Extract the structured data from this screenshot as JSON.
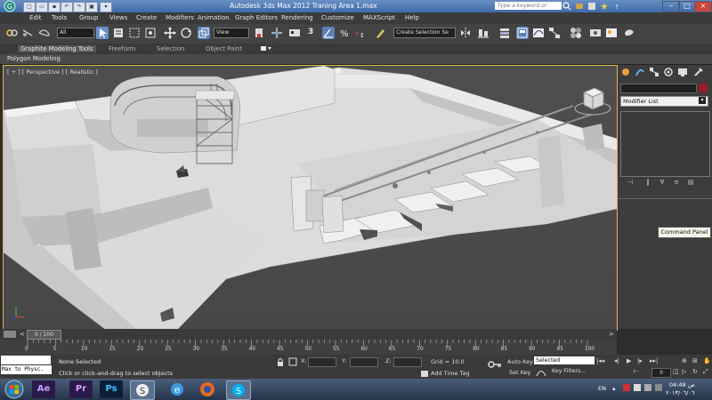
{
  "titlebar": {
    "title": "Autodesk 3ds Max  2012     Traning Area 1.max",
    "search_placeholder": "Type a keyword or phrase",
    "min": "–",
    "max": "□",
    "close": "×"
  },
  "menu": [
    "Edit",
    "Tools",
    "Group",
    "Views",
    "Create",
    "Modifiers",
    "Animation",
    "Graph Editors",
    "Rendering",
    "Customize",
    "MAXScript",
    "Help"
  ],
  "toolbar": {
    "filter_value": "All",
    "refcoord_value": "View",
    "selection_set_value": "Create Selection Se",
    "snap_label": "3",
    "angle_snap_label": "n"
  },
  "ribbon": {
    "tabs": [
      "Graphite Modeling Tools",
      "Freeform",
      "Selection",
      "Object Paint"
    ],
    "sub_label": "Polygon Modeling"
  },
  "viewport": {
    "label": "[ + ] [ Perspective ] [ Realistic ]"
  },
  "command_panel": {
    "modifier_list": "Modifier List",
    "tooltip": "Command Panel",
    "colors": {
      "object_color": "#9a1c2c"
    }
  },
  "timeline": {
    "slider_label": "0 / 100",
    "ticks": [
      "0",
      "5",
      "10",
      "15",
      "20",
      "25",
      "30",
      "35",
      "40",
      "45",
      "50",
      "55",
      "60",
      "65",
      "70",
      "75",
      "80",
      "85",
      "90",
      "95",
      "100"
    ]
  },
  "status": {
    "maxscript_text": "Max to Physc.",
    "selected_text": "None Selected",
    "prompt_text": "Click or click-and-drag to select objects",
    "x_label": "X:",
    "y_label": "Y:",
    "z_label": "Z:",
    "grid_text": "Grid = 10.0",
    "add_time_tag": "Add Time Tag",
    "auto_key": "Auto Key",
    "set_key": "Set Key",
    "selected_dropdown": "Selected",
    "key_filters": "Key Filters...",
    "frame_value": "0"
  },
  "taskbar": {
    "apps": [
      "Ae",
      "Pr",
      "Ps"
    ],
    "lang": "EN",
    "time": "04:48 ﻿ﺹ",
    "date": "٢٠١٣/٠٦/٠٦"
  }
}
